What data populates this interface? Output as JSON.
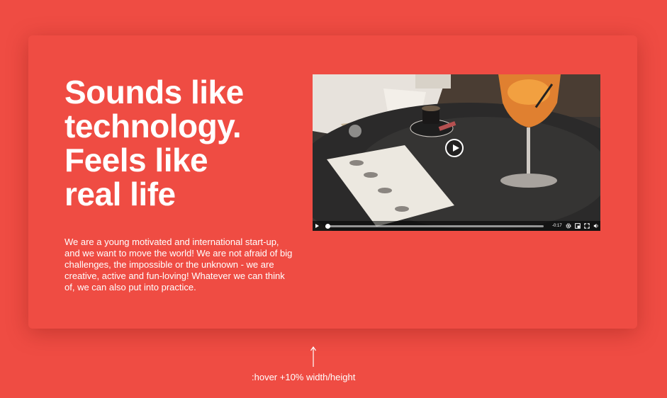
{
  "card": {
    "headline": [
      "Sounds like",
      "technology.",
      "Feels like",
      "real life"
    ],
    "description": "We are a young motivated and international start-up, and we want to move the world! We are not afraid of big challenges, the impossible or the unknown - we are creative, active and fun-loving! Whatever we can think of, we can also put into practice."
  },
  "video": {
    "time_remaining": "-0:17",
    "progress": 0.01,
    "icons": [
      "play-icon",
      "settings-gear-icon",
      "picture-in-picture-icon",
      "fullscreen-icon",
      "volume-icon"
    ]
  },
  "hint": {
    "text": ":hover +10% width/height"
  },
  "colors": {
    "background": "#ef4c43",
    "text": "#ffffff"
  }
}
